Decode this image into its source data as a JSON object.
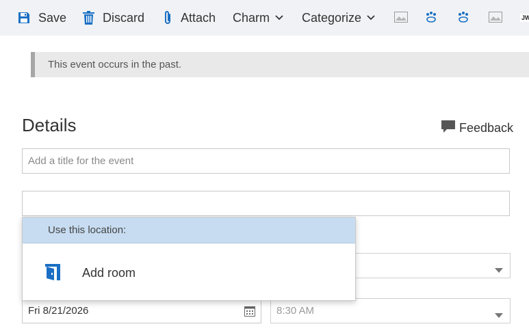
{
  "toolbar": {
    "save_label": "Save",
    "discard_label": "Discard",
    "attach_label": "Attach",
    "charm_label": "Charm",
    "categorize_label": "Categorize",
    "icons": [
      "image-icon",
      "paw-icon",
      "paw-icon",
      "image-icon"
    ],
    "accent": "#1a6fc4",
    "truncated_badge": "JW"
  },
  "banner": {
    "text": "This event occurs in the past."
  },
  "details": {
    "title": "Details",
    "feedback_label": "Feedback"
  },
  "form": {
    "title_placeholder": "Add a title for the event",
    "location_value": "",
    "date_value": "Fri 8/21/2026",
    "time_value": "8:30 AM",
    "upper_select_value": ""
  },
  "location_dropdown": {
    "header": "Use this location:",
    "items": [
      {
        "label": "Add room",
        "icon": "room-icon"
      }
    ]
  },
  "colors": {
    "toolbar_bg": "#f0f2f5",
    "banner_bg": "#e9e9e9",
    "dropdown_header_bg": "#c7dcf1",
    "icon_blue": "#1a6fc4"
  }
}
